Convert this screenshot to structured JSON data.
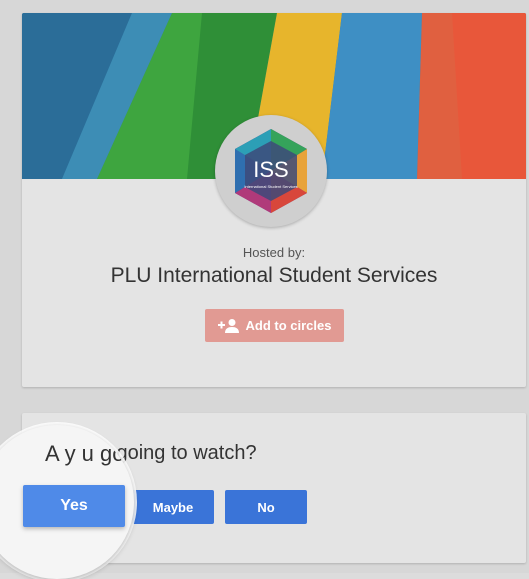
{
  "event": {
    "hosted_label": "Hosted by:",
    "host_name": "PLU International Student Services",
    "add_to_circles_label": "Add to circles",
    "avatar_text": "ISS",
    "avatar_subtext": "International Student Services"
  },
  "rsvp": {
    "question": "Are you going to watch?",
    "magnified_question": "A  y  u going to watch?",
    "buttons": {
      "yes": "Yes",
      "maybe": "Maybe",
      "no": "No"
    }
  },
  "icons": {
    "add": "add-person-icon",
    "logo": "iss-hexagon-logo"
  },
  "colors": {
    "primary_button": "#3a74d8",
    "yes_button": "#4f8ae8",
    "add_button": "#e19a93",
    "card": "#e4e4e4"
  }
}
